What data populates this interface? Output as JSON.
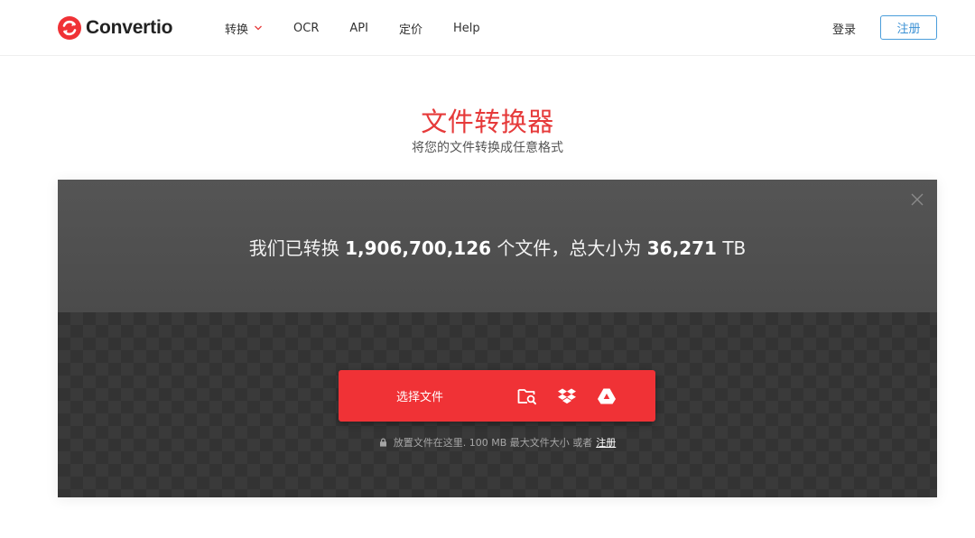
{
  "header": {
    "logo_text": "Convertio",
    "nav": [
      {
        "label": "转换",
        "has_dropdown": true
      },
      {
        "label": "OCR"
      },
      {
        "label": "API"
      },
      {
        "label": "定价"
      },
      {
        "label": "Help"
      }
    ],
    "login": "登录",
    "signup": "注册"
  },
  "hero": {
    "title": "文件转换器",
    "subtitle": "将您的文件转换成任意格式"
  },
  "stats": {
    "prefix": "我们已转换",
    "files_count": "1,906,700,126",
    "middle": "个文件，总大小为",
    "total_size": "36,271",
    "unit": "TB"
  },
  "upload": {
    "choose_label": "选择文件",
    "sources": [
      "folder-search-icon",
      "dropbox-icon",
      "google-drive-icon"
    ],
    "hint_text": "放置文件在这里. 100 MB 最大文件大小 或者",
    "hint_link": "注册"
  },
  "colors": {
    "brand_red": "#f03236",
    "title_red": "#e63a3a",
    "signup_blue": "#3a90d4"
  }
}
